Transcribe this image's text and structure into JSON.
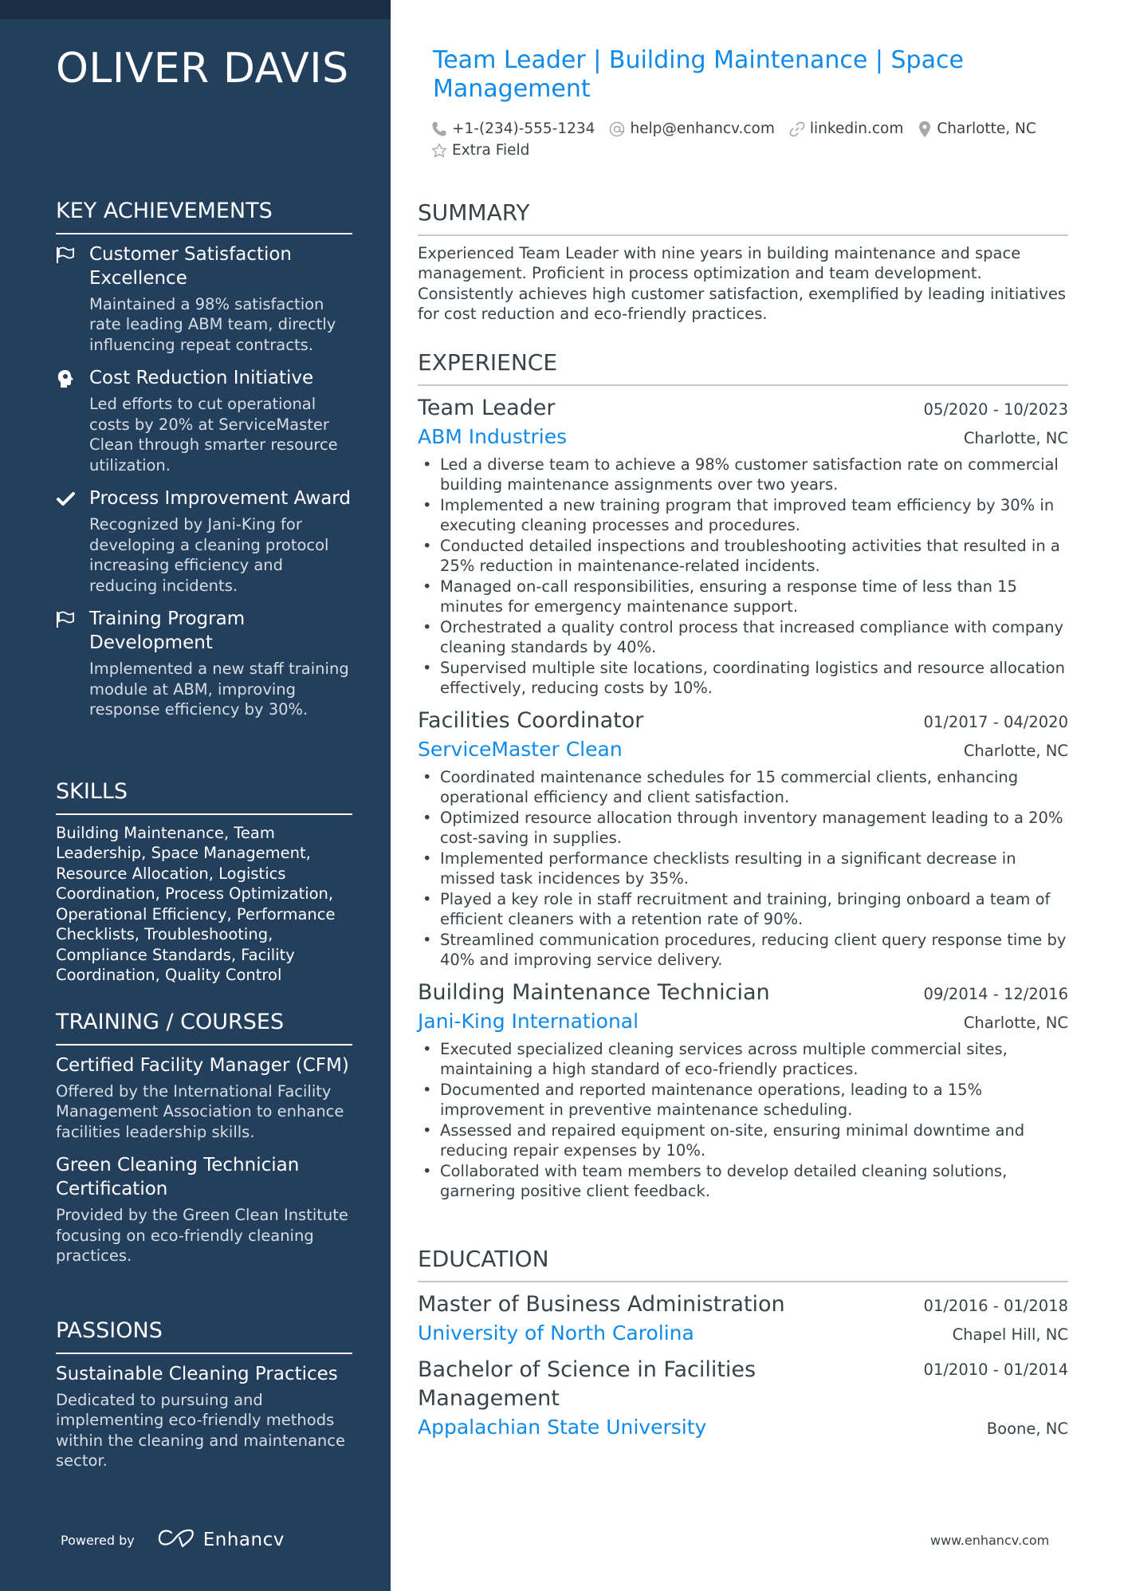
{
  "name": "OLIVER DAVIS",
  "headline": "Team Leader | Building Maintenance | Space Management",
  "contacts": [
    {
      "icon": "phone-icon",
      "text": "+1-(234)-555-1234"
    },
    {
      "icon": "at-icon",
      "text": "help@enhancv.com"
    },
    {
      "icon": "link-icon",
      "text": "linkedin.com"
    },
    {
      "icon": "location-icon",
      "text": "Charlotte, NC"
    },
    {
      "icon": "star-icon",
      "text": "Extra Field"
    }
  ],
  "sidebar": {
    "achievements": {
      "title": "KEY ACHIEVEMENTS",
      "items": [
        {
          "icon": "flag-icon",
          "title": "Customer Satisfaction Excellence",
          "desc": "Maintained a 98% satisfaction rate leading ABM team, directly influencing repeat contracts."
        },
        {
          "icon": "head-icon",
          "title": "Cost Reduction Initiative",
          "desc": "Led efforts to cut operational costs by 20% at ServiceMaster Clean through smarter resource utilization."
        },
        {
          "icon": "check-icon",
          "title": "Process Improvement Award",
          "desc": "Recognized by Jani-King for developing a cleaning protocol increasing efficiency and reducing incidents."
        },
        {
          "icon": "flag-icon",
          "title": "Training Program Development",
          "desc": "Implemented a new staff training module at ABM, improving response efficiency by 30%."
        }
      ]
    },
    "skills": {
      "title": "SKILLS",
      "text": "Building Maintenance, Team Leadership, Space Management, Resource Allocation, Logistics Coordination, Process Optimization, Operational Efficiency, Performance Checklists, Troubleshooting, Compliance Standards, Facility Coordination, Quality Control"
    },
    "training": {
      "title": "TRAINING / COURSES",
      "items": [
        {
          "title": "Certified Facility Manager (CFM)",
          "desc": "Offered by the International Facility Management Association to enhance facilities leadership skills."
        },
        {
          "title": "Green Cleaning Technician Certification",
          "desc": "Provided by the Green Clean Institute focusing on eco-friendly cleaning practices."
        }
      ]
    },
    "passions": {
      "title": "PASSIONS",
      "items": [
        {
          "title": "Sustainable Cleaning Practices",
          "desc": "Dedicated to pursuing and implementing eco-friendly methods within the cleaning and maintenance sector."
        }
      ]
    },
    "powered_by": "Powered by",
    "brand": "Enhancv"
  },
  "summary": {
    "title": "SUMMARY",
    "text": "Experienced Team Leader with nine years in building maintenance and space management. Proficient in process optimization and team development. Consistently achieves high customer satisfaction, exemplified by leading initiatives for cost reduction and eco-friendly practices."
  },
  "experience": {
    "title": "EXPERIENCE",
    "jobs": [
      {
        "title": "Team Leader",
        "dates": "05/2020 - 10/2023",
        "company": "ABM Industries",
        "location": "Charlotte, NC",
        "bullets": [
          "Led a diverse team to achieve a 98% customer satisfaction rate on commercial building maintenance assignments over two years.",
          "Implemented a new training program that improved team efficiency by 30% in executing cleaning processes and procedures.",
          "Conducted detailed inspections and troubleshooting activities that resulted in a 25% reduction in maintenance-related incidents.",
          "Managed on-call responsibilities, ensuring a response time of less than 15 minutes for emergency maintenance support.",
          "Orchestrated a quality control process that increased compliance with company cleaning standards by 40%.",
          "Supervised multiple site locations, coordinating logistics and resource allocation effectively, reducing costs by 10%."
        ]
      },
      {
        "title": "Facilities Coordinator",
        "dates": "01/2017 - 04/2020",
        "company": "ServiceMaster Clean",
        "location": "Charlotte, NC",
        "bullets": [
          "Coordinated maintenance schedules for 15 commercial clients, enhancing operational efficiency and client satisfaction.",
          "Optimized resource allocation through inventory management leading to a 20% cost-saving in supplies.",
          "Implemented performance checklists resulting in a significant decrease in missed task incidences by 35%.",
          "Played a key role in staff recruitment and training, bringing onboard a team of efficient cleaners with a retention rate of 90%.",
          "Streamlined communication procedures, reducing client query response time by 40% and improving service delivery."
        ]
      },
      {
        "title": "Building Maintenance Technician",
        "dates": "09/2014 - 12/2016",
        "company": "Jani-King International",
        "location": "Charlotte, NC",
        "bullets": [
          "Executed specialized cleaning services across multiple commercial sites, maintaining a high standard of eco-friendly practices.",
          "Documented and reported maintenance operations, leading to a 15% improvement in preventive maintenance scheduling.",
          "Assessed and repaired equipment on-site, ensuring minimal downtime and reducing repair expenses by 10%.",
          "Collaborated with team members to develop detailed cleaning solutions, garnering positive client feedback."
        ]
      }
    ]
  },
  "education": {
    "title": "EDUCATION",
    "items": [
      {
        "degree": "Master of Business Administration",
        "dates": "01/2016 - 01/2018",
        "school": "University of North Carolina",
        "location": "Chapel Hill, NC"
      },
      {
        "degree": "Bachelor of Science in Facilities Management",
        "dates": "01/2010 - 01/2014",
        "school": "Appalachian State University",
        "location": "Boone, NC"
      }
    ]
  },
  "footer_url": "www.enhancv.com",
  "colors": {
    "sidebar": "#233f5c",
    "sidebar_band": "#1b2d44",
    "accent": "#108ae8",
    "text": "#384347"
  }
}
